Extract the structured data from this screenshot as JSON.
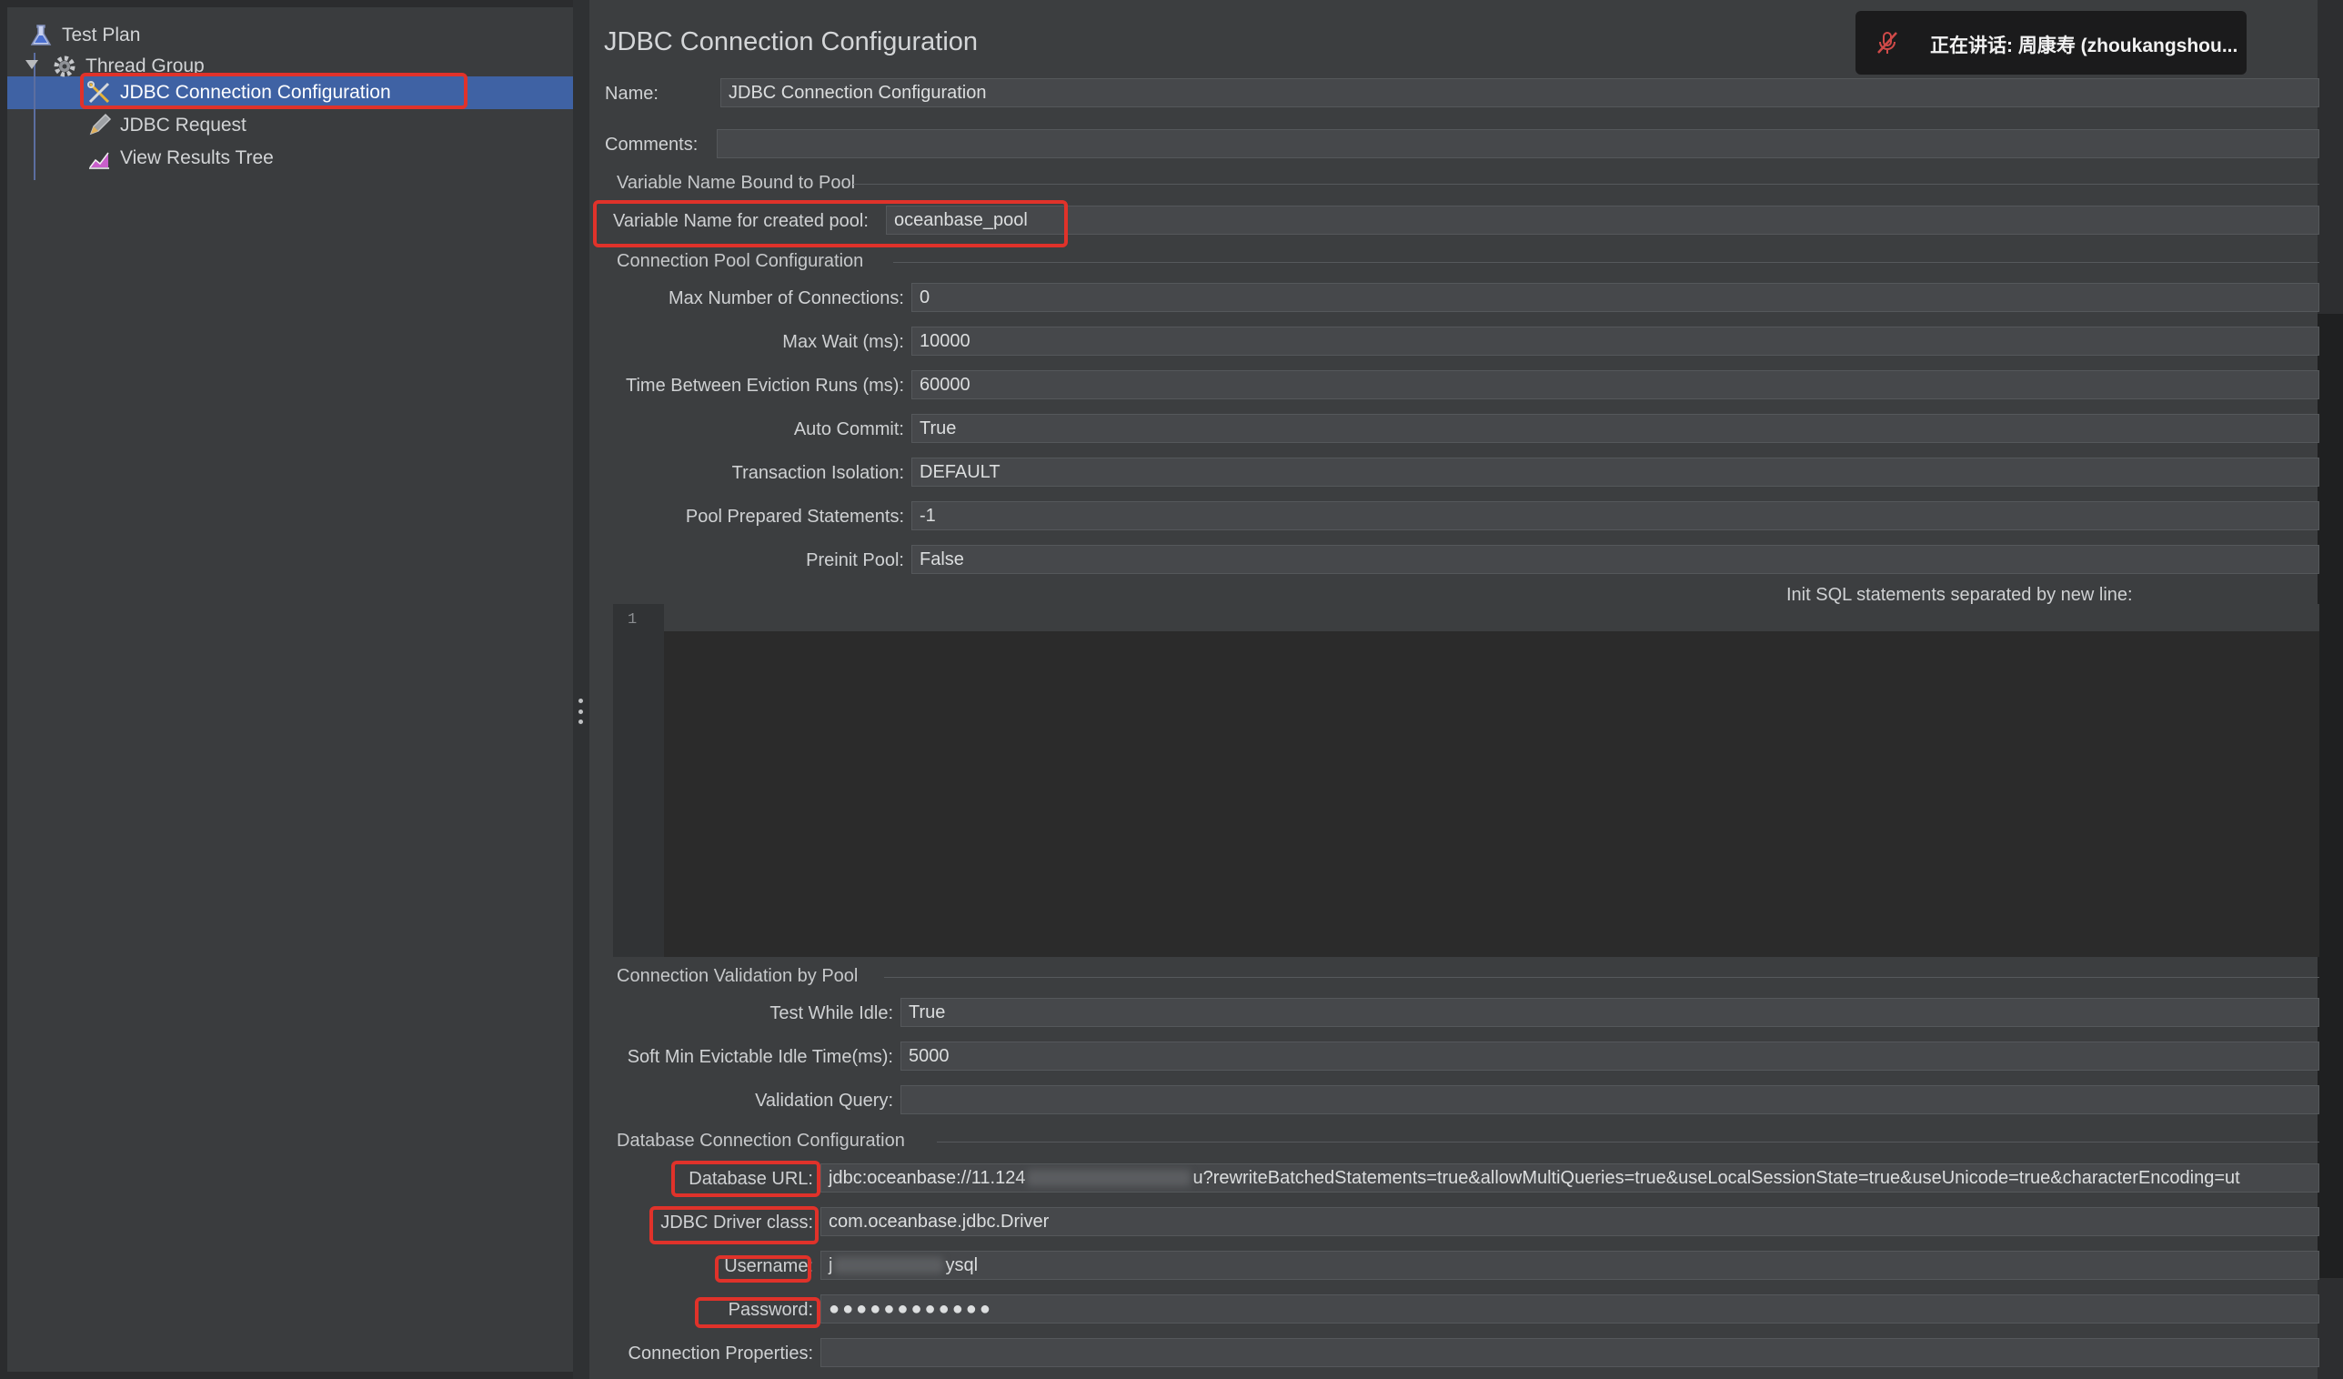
{
  "tree": {
    "items": [
      {
        "label": "Test Plan",
        "icon": "flask-icon"
      },
      {
        "label": "Thread Group",
        "icon": "gear-icon"
      },
      {
        "label": "JDBC Connection Configuration",
        "icon": "wrench-screwdriver-icon"
      },
      {
        "label": "JDBC Request",
        "icon": "pencil-icon"
      },
      {
        "label": "View Results Tree",
        "icon": "chart-icon"
      }
    ]
  },
  "panel": {
    "title": "JDBC Connection Configuration",
    "name_label": "Name:",
    "name_value": "JDBC Connection Configuration",
    "comments_label": "Comments:",
    "comments_value": ""
  },
  "variable_section": {
    "title": "Variable Name Bound to Pool",
    "pool_label": "Variable Name for created pool:",
    "pool_value": "oceanbase_pool"
  },
  "pool_config": {
    "title": "Connection Pool Configuration",
    "fields": [
      {
        "label": "Max Number of Connections:",
        "value": "0"
      },
      {
        "label": "Max Wait (ms):",
        "value": "10000"
      },
      {
        "label": "Time Between Eviction Runs (ms):",
        "value": "60000"
      },
      {
        "label": "Auto Commit:",
        "value": "True"
      },
      {
        "label": "Transaction Isolation:",
        "value": "DEFAULT"
      },
      {
        "label": "Pool Prepared Statements:",
        "value": "-1"
      },
      {
        "label": "Preinit Pool:",
        "value": "False"
      }
    ],
    "init_sql_label": "Init SQL statements separated by new line:",
    "editor_line_number": "1"
  },
  "validation": {
    "title": "Connection Validation by Pool",
    "fields": [
      {
        "label": "Test While Idle:",
        "value": "True"
      },
      {
        "label": "Soft Min Evictable Idle Time(ms):",
        "value": "5000"
      },
      {
        "label": "Validation Query:",
        "value": ""
      }
    ]
  },
  "db_config": {
    "title": "Database Connection Configuration",
    "url_label": "Database URL:",
    "url_prefix": "jdbc:oceanbase://11.124",
    "url_suffix": "u?rewriteBatchedStatements=true&allowMultiQueries=true&useLocalSessionState=true&useUnicode=true&characterEncoding=ut",
    "driver_label": "JDBC Driver class:",
    "driver_value": "com.oceanbase.jdbc.Driver",
    "username_label": "Username:",
    "username_prefix": "j",
    "username_suffix": "ysql",
    "password_label": "Password:",
    "password_value": "●●●●●●●●●●●●",
    "properties_label": "Connection Properties:",
    "properties_value": ""
  },
  "notification": {
    "text": "正在讲话: 周康寿 (zhoukangshou...",
    "icon": "microphone-muted-icon"
  },
  "colors": {
    "highlight": "#e0322a",
    "selection": "#3f62a4"
  }
}
